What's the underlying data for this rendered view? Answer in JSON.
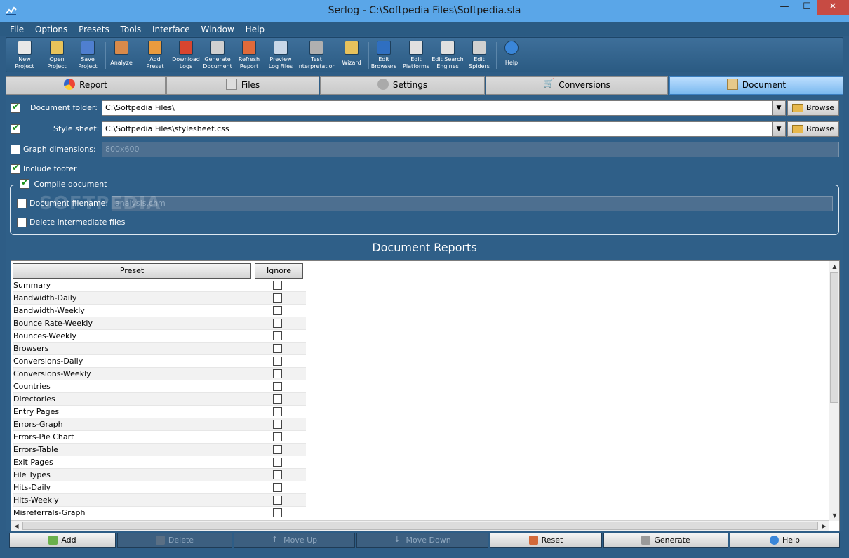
{
  "window": {
    "title": "Serlog - C:\\Softpedia Files\\Softpedia.sla",
    "minimize": "—",
    "maximize": "☐",
    "close": "✕"
  },
  "menu": [
    "File",
    "Options",
    "Presets",
    "Tools",
    "Interface",
    "Window",
    "Help"
  ],
  "toolbar": [
    {
      "l1": "New",
      "l2": "Project",
      "color": "#e8e8e8"
    },
    {
      "l1": "Open",
      "l2": "Project",
      "color": "#e8c35a"
    },
    {
      "l1": "Save",
      "l2": "Project",
      "color": "#4f7fd0"
    },
    {
      "l1": "Analyze",
      "l2": "",
      "color": "#d98a4a"
    },
    {
      "l1": "Add",
      "l2": "Preset",
      "color": "#e99b3e"
    },
    {
      "l1": "Download",
      "l2": "Logs",
      "color": "#d9452f"
    },
    {
      "l1": "Generate",
      "l2": "Document",
      "color": "#d0d0d0"
    },
    {
      "l1": "Refresh",
      "l2": "Report",
      "color": "#e06a3a"
    },
    {
      "l1": "Preview",
      "l2": "Log Files",
      "color": "#c8d7e8"
    },
    {
      "l1": "Test",
      "l2": "Interpretation",
      "color": "#b0b0b0"
    },
    {
      "l1": "Wizard",
      "l2": "",
      "color": "#e7c25c"
    },
    {
      "l1": "Edit",
      "l2": "Browsers",
      "color": "#2f6fc1"
    },
    {
      "l1": "Edit",
      "l2": "Platforms",
      "color": "#e0e0e0"
    },
    {
      "l1": "Edit Search",
      "l2": "Engines",
      "color": "#e0e0e0"
    },
    {
      "l1": "Edit",
      "l2": "Spiders",
      "color": "#d0d0d0"
    },
    {
      "l1": "Help",
      "l2": "",
      "color": "#3a86d9"
    }
  ],
  "tabs": [
    "Report",
    "Files",
    "Settings",
    "Conversions",
    "Document"
  ],
  "form": {
    "doc_folder_label": "Document folder:",
    "doc_folder_value": "C:\\Softpedia Files\\",
    "style_sheet_label": "Style sheet:",
    "style_sheet_value": "C:\\Softpedia Files\\stylesheet.css",
    "graph_dim_label": "Graph dimensions:",
    "graph_dim_value": "800x600",
    "include_footer_label": "Include footer",
    "browse_label": "Browse",
    "compile_label": "Compile document",
    "doc_filename_label": "Document filename:",
    "doc_filename_value": "analysis.chm",
    "delete_intermediate_label": "Delete intermediate files"
  },
  "watermark": "SOFTPEDIA",
  "reports": {
    "title": "Document Reports",
    "col_preset": "Preset",
    "col_ignore": "Ignore",
    "rows": [
      "Summary",
      "Bandwidth-Daily",
      "Bandwidth-Weekly",
      "Bounce Rate-Weekly",
      "Bounces-Weekly",
      "Browsers",
      "Conversions-Daily",
      "Conversions-Weekly",
      "Countries",
      "Directories",
      "Entry Pages",
      "Errors-Graph",
      "Errors-Pie Chart",
      "Errors-Table",
      "Exit Pages",
      "File Types",
      "Hits-Daily",
      "Hits-Weekly",
      "Misreferrals-Graph"
    ]
  },
  "bottom_buttons": [
    "Add",
    "Delete",
    "Move Up",
    "Move Down",
    "Reset",
    "Generate",
    "Help"
  ]
}
